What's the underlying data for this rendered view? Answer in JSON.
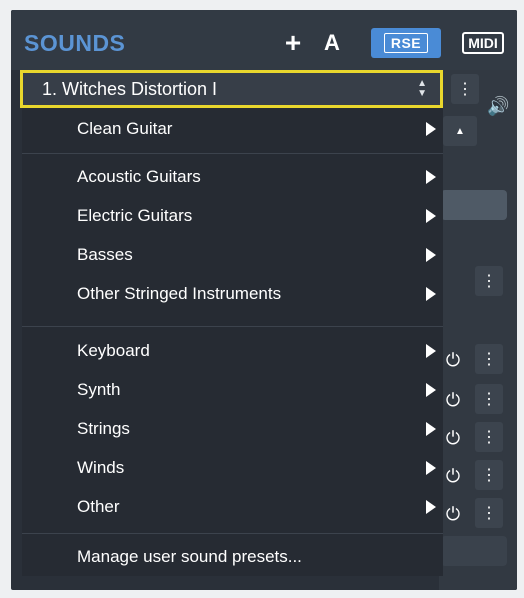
{
  "header": {
    "title": "SOUNDS",
    "add_label": "+",
    "auto_label": "A",
    "rse_label": "RSE",
    "midi_label": "MIDI"
  },
  "selector": {
    "current": "1. Witches Distortion I",
    "arrows_icon": "updown-chevrons-icon"
  },
  "menu": {
    "items": [
      {
        "label": "Clean Guitar",
        "has_submenu": true
      },
      {
        "label": "Acoustic Guitars",
        "has_submenu": true
      },
      {
        "label": "Electric Guitars",
        "has_submenu": true
      },
      {
        "label": "Basses",
        "has_submenu": true
      },
      {
        "label": "Other Stringed Instruments",
        "has_submenu": true
      },
      {
        "label": "Keyboard",
        "has_submenu": true
      },
      {
        "label": "Synth",
        "has_submenu": true
      },
      {
        "label": "Strings",
        "has_submenu": true
      },
      {
        "label": "Winds",
        "has_submenu": true
      },
      {
        "label": "Other",
        "has_submenu": true
      },
      {
        "label": "Manage user sound presets...",
        "has_submenu": false
      }
    ]
  },
  "side": {
    "more_glyph": "⋮",
    "speaker_glyph": "🔊",
    "knob_glyph": "⏻"
  },
  "colors": {
    "accent": "#5b94d4",
    "rse_bg": "#4a8bd6",
    "highlight_border": "#e9d72d",
    "panel_bg": "#2a3039",
    "menu_bg": "#262b33"
  }
}
